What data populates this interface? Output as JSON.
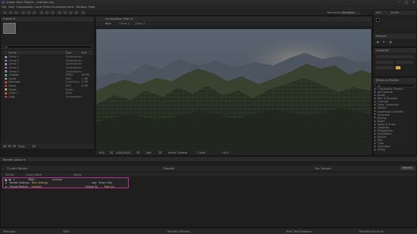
{
  "app": {
    "title": "Adobe After Effects - Untitled.aep",
    "window_controls": [
      "–",
      "□",
      "×"
    ]
  },
  "menu": [
    "File",
    "Edit",
    "Composition",
    "Layer",
    "Effect",
    "Animation",
    "View",
    "Window",
    "Help"
  ],
  "toolbar": {
    "workspace_label": "Workspace:",
    "workspace_value": "Standard",
    "search_placeholder": "Search Help"
  },
  "project_panel": {
    "tab": "Project ≡",
    "search_placeholder": "ρ▾",
    "columns": {
      "name": "Name",
      "type": "Type",
      "size": "Size"
    },
    "items": [
      {
        "name": "Comp 1",
        "type": "Composition",
        "size": "",
        "color": "#8a7fb0"
      },
      {
        "name": "Comp 2",
        "type": "Composition",
        "size": "",
        "color": "#8a7fb0"
      },
      {
        "name": "Comp 3",
        "type": "Composition",
        "size": "",
        "color": "#8a7fb0"
      },
      {
        "name": "Comp 4",
        "type": "Composition",
        "size": "",
        "color": "#8a7fb0"
      },
      {
        "name": "Comp 5",
        "type": "Composition",
        "size": "",
        "color": "#8a7fb0"
      },
      {
        "name": "Footage",
        "type": "MPEG",
        "size": "48 MB",
        "color": "#5f8f8a"
      },
      {
        "name": "Audio",
        "type": "WAV",
        "size": "2 MB",
        "color": "#b0a060"
      },
      {
        "name": "Mountain",
        "type": "QuickTime",
        "size": "3 MB",
        "color": "#b04a4a"
      },
      {
        "name": "Music",
        "type": "MP3",
        "size": "6 MB",
        "color": "#b04a4a"
      },
      {
        "name": "Solids",
        "type": "Folder",
        "size": "",
        "color": "#b0a060"
      },
      {
        "name": "Layer 1",
        "type": "Solid",
        "size": "",
        "color": "#b04a4a"
      },
      {
        "name": "Logo",
        "type": "Composition",
        "size": "",
        "color": "#b04a4a"
      }
    ],
    "bpc": "8 bpc"
  },
  "composition_panel": {
    "tab": "Composition: Main ≡",
    "subtabs": [
      "Main",
      "Comp 1",
      "Comp 2"
    ],
    "zoom": "50%",
    "time": "0;00;00;00",
    "resolution": "Half",
    "camera": "Active Camera",
    "views": "1 View",
    "exposure": "+0.0"
  },
  "right_panel": {
    "info_tab": "Info",
    "audio_tab": "Audio",
    "preview_tab": "Preview",
    "character_tab": "Character",
    "effects_tab": "Effects & Presets",
    "effects_search_placeholder": "ρ▾",
    "effects": [
      "* Animation Presets",
      "3D Channel",
      "Audio",
      "Blur & Sharpen",
      "Channel",
      "Color Correction",
      "Distort",
      "Expression Controls",
      "Generate",
      "Keying",
      "Matte",
      "Noise & Grain",
      "Obsolete",
      "Perspective",
      "Simulation",
      "Stylize",
      "Text",
      "Time",
      "Transition",
      "Utility"
    ]
  },
  "render_queue": {
    "tab": "Render Queue ≡",
    "current_render_label": "Current Render",
    "elapsed_label": "Elapsed:",
    "remaining_label": "Est. Remain:",
    "render_button": "Render",
    "columns": {
      "render": "Render",
      "comp_name": "Comp Name",
      "status": "Status"
    },
    "item": {
      "index": "1",
      "comp_name": "Main",
      "status": "Queued",
      "render_settings_label": "Render Settings:",
      "render_settings_value": "Best Settings",
      "output_module_label": "Output Module:",
      "output_module_value": "Lossless",
      "log_label": "Log:",
      "log_value": "Errors Only",
      "output_to_label": "Output To:",
      "output_to_value": "Main.avi"
    }
  },
  "status_bar": {
    "message": "Message:",
    "ram": "RAM:",
    "renders_started": "Renders Started:",
    "total_time_elapsed": "Total Time Elapsed:",
    "most_recent_error": "Most Recent Error:"
  },
  "colors": {
    "highlight": "#b3338f",
    "accent": "#d6a54a",
    "background": "#1b1b1b"
  }
}
